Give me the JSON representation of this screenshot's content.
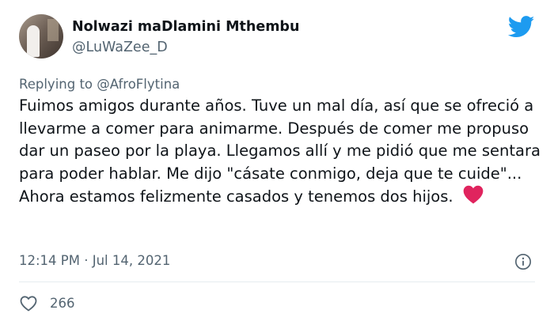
{
  "author": {
    "display_name": "Nolwazi maDlamini Mthembu",
    "handle": "@LuWaZee_D"
  },
  "reply": {
    "prefix": "Replying to ",
    "mention": "@AfroFlytina"
  },
  "tweet": {
    "text": "Fuimos amigos durante años. Tuve un mal día, así que se ofreció a llevarme a comer para animarme. Después de comer me propuso dar un paseo por la playa. Llegamos allí y me pidió que me sentara para poder hablar. Me dijo \"cásate conmigo, deja que te cuide\"... Ahora estamos felizmente casados y tenemos dos hijos.",
    "emoji": "red-heart",
    "timestamp": "12:14 PM · Jul 14, 2021"
  },
  "engagement": {
    "likes": "266"
  },
  "icons": {
    "brand": "twitter-bird-icon",
    "info": "info-icon",
    "like": "heart-outline-icon"
  },
  "colors": {
    "brand_blue": "#1d9bf0",
    "text_primary": "#0f1419",
    "text_secondary": "#536471",
    "heart_red": "#e0245e",
    "divider": "#e6ecf0"
  }
}
